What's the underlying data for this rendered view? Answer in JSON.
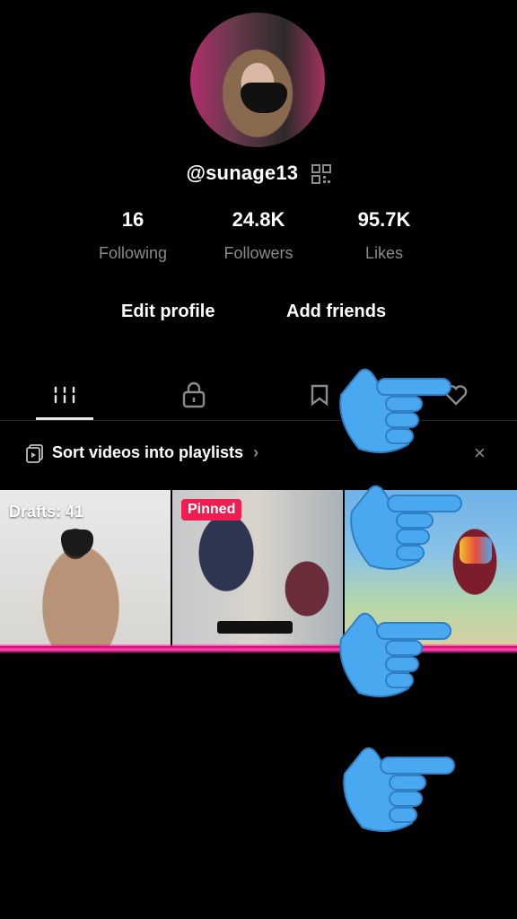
{
  "profile": {
    "username": "@sunage13",
    "avatar_icon": "profile-avatar",
    "qr_icon": "qr-code-icon"
  },
  "stats": [
    {
      "value": "16",
      "label": "Following"
    },
    {
      "value": "24.8K",
      "label": "Followers"
    },
    {
      "value": "95.7K",
      "label": "Likes"
    }
  ],
  "actions": {
    "edit_profile": "Edit profile",
    "add_friends": "Add friends"
  },
  "tabs": [
    {
      "icon": "videos-grid-icon",
      "active": true
    },
    {
      "icon": "lock-icon",
      "active": false
    },
    {
      "icon": "bookmark-icon",
      "active": false
    },
    {
      "icon": "liked-icon",
      "active": false
    }
  ],
  "playlist_bar": {
    "text": "Sort videos into playlists",
    "chevron": "›",
    "close": "×"
  },
  "videos": [
    {
      "label": "Drafts: 41"
    },
    {
      "label": "Pinned"
    },
    {
      "label": ""
    }
  ],
  "colors": {
    "background": "#000000",
    "accent_pink": "#ee1d52",
    "neon_line": "#ff1493",
    "hand_blue": "#4aa8f0"
  }
}
